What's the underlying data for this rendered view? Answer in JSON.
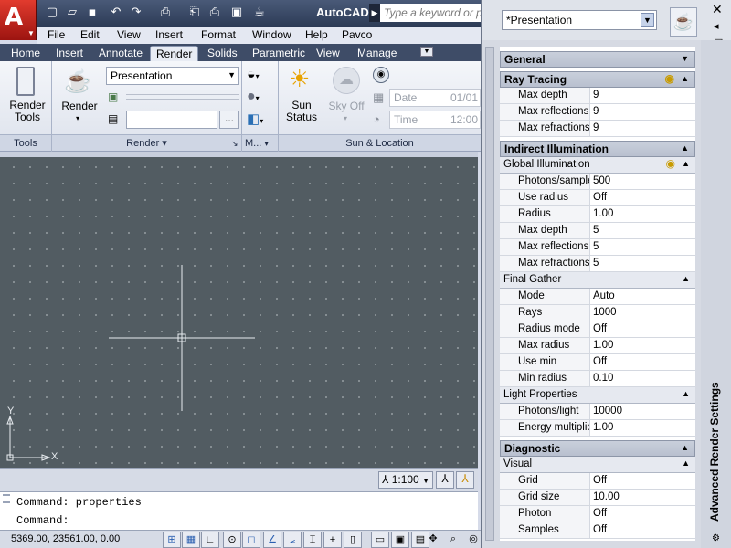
{
  "app": {
    "title": "AutoCAD",
    "search_placeholder": "Type a keyword or p"
  },
  "logo": {
    "letter": "A"
  },
  "quick_access": [
    {
      "icon": "new-icon",
      "glyph": "▢"
    },
    {
      "icon": "open-icon",
      "glyph": "▱"
    },
    {
      "icon": "save-icon",
      "glyph": "▪"
    },
    {
      "icon": "undo-icon",
      "glyph": "↶"
    },
    {
      "icon": "redo-icon",
      "glyph": "↷"
    },
    {
      "icon": "plot-icon",
      "glyph": "⎙"
    },
    {
      "icon": "publish-icon",
      "glyph": "⎗"
    },
    {
      "icon": "print-preview-icon",
      "glyph": "⎙"
    },
    {
      "icon": "properties-icon",
      "glyph": "▣"
    },
    {
      "icon": "render-teapot-icon",
      "glyph": "☕"
    }
  ],
  "menu": [
    "File",
    "Edit",
    "View",
    "Insert",
    "Format",
    "Window",
    "Help",
    "Pavco"
  ],
  "tabs": [
    {
      "label": "Home",
      "active": false
    },
    {
      "label": "Insert",
      "active": false
    },
    {
      "label": "Annotate",
      "active": false
    },
    {
      "label": "Render",
      "active": true
    },
    {
      "label": "Solids",
      "active": false
    },
    {
      "label": "Parametric",
      "active": false
    },
    {
      "label": "View",
      "active": false
    },
    {
      "label": "Manage",
      "active": false
    }
  ],
  "ribbon": {
    "tools": {
      "button": "Render\nTools",
      "panel": "Tools"
    },
    "render": {
      "button": "Render",
      "preset": "Presentation",
      "panel": "Render",
      "panel_arrow": "▾",
      "ellipsis": "..."
    },
    "materials": {
      "panel": "M..."
    },
    "sun": {
      "status_label": "Sun\nStatus",
      "sky_label": "Sky Off",
      "date_label": "Date",
      "date_value": "01/01",
      "time_label": "Time",
      "time_value": "12:00",
      "panel": "Sun & Location"
    }
  },
  "viewport": {
    "ucs_y": "Y",
    "ucs_x": "X",
    "scale": "1:100"
  },
  "command": {
    "history": "Command: properties",
    "prompt": "Command:"
  },
  "status": {
    "coords": "5369.00,   23561.00, 0.00"
  },
  "palette": {
    "title": "Advanced Render Settings",
    "preset": "*Presentation",
    "sections": [
      {
        "type": "section",
        "label": "General"
      },
      {
        "type": "section",
        "label": "Ray Tracing",
        "bulb": true
      },
      {
        "type": "row",
        "key": "Max depth",
        "value": "9"
      },
      {
        "type": "row",
        "key": "Max reflections",
        "value": "9"
      },
      {
        "type": "row",
        "key": "Max refractions",
        "value": "9"
      },
      {
        "type": "section",
        "label": "Indirect Illumination"
      },
      {
        "type": "sub",
        "label": "Global Illumination",
        "bulb": true
      },
      {
        "type": "row",
        "key": "Photons/sample",
        "value": "500"
      },
      {
        "type": "row",
        "key": "Use radius",
        "value": "Off"
      },
      {
        "type": "row",
        "key": "Radius",
        "value": "1.00"
      },
      {
        "type": "row",
        "key": "Max depth",
        "value": "5"
      },
      {
        "type": "row",
        "key": "Max reflections",
        "value": "5"
      },
      {
        "type": "row",
        "key": "Max refractions",
        "value": "5"
      },
      {
        "type": "sub",
        "label": "Final Gather"
      },
      {
        "type": "row",
        "key": "Mode",
        "value": "Auto"
      },
      {
        "type": "row",
        "key": "Rays",
        "value": "1000"
      },
      {
        "type": "row",
        "key": "Radius mode",
        "value": "Off"
      },
      {
        "type": "row",
        "key": "Max radius",
        "value": "1.00"
      },
      {
        "type": "row",
        "key": "Use min",
        "value": "Off"
      },
      {
        "type": "row",
        "key": "Min radius",
        "value": "0.10"
      },
      {
        "type": "sub",
        "label": "Light Properties"
      },
      {
        "type": "row",
        "key": "Photons/light",
        "value": "10000"
      },
      {
        "type": "row",
        "key": "Energy multiplier",
        "value": "1.00"
      },
      {
        "type": "section",
        "label": "Diagnostic"
      },
      {
        "type": "sub",
        "label": "Visual"
      },
      {
        "type": "row",
        "key": "Grid",
        "value": "Off"
      },
      {
        "type": "row",
        "key": "Grid size",
        "value": "10.00"
      },
      {
        "type": "row",
        "key": "Photon",
        "value": "Off"
      },
      {
        "type": "row",
        "key": "Samples",
        "value": "Off"
      }
    ]
  },
  "colors": {
    "titlebar": "#2c3a55",
    "viewport": "#525c62",
    "accent": "#e23b2e"
  }
}
